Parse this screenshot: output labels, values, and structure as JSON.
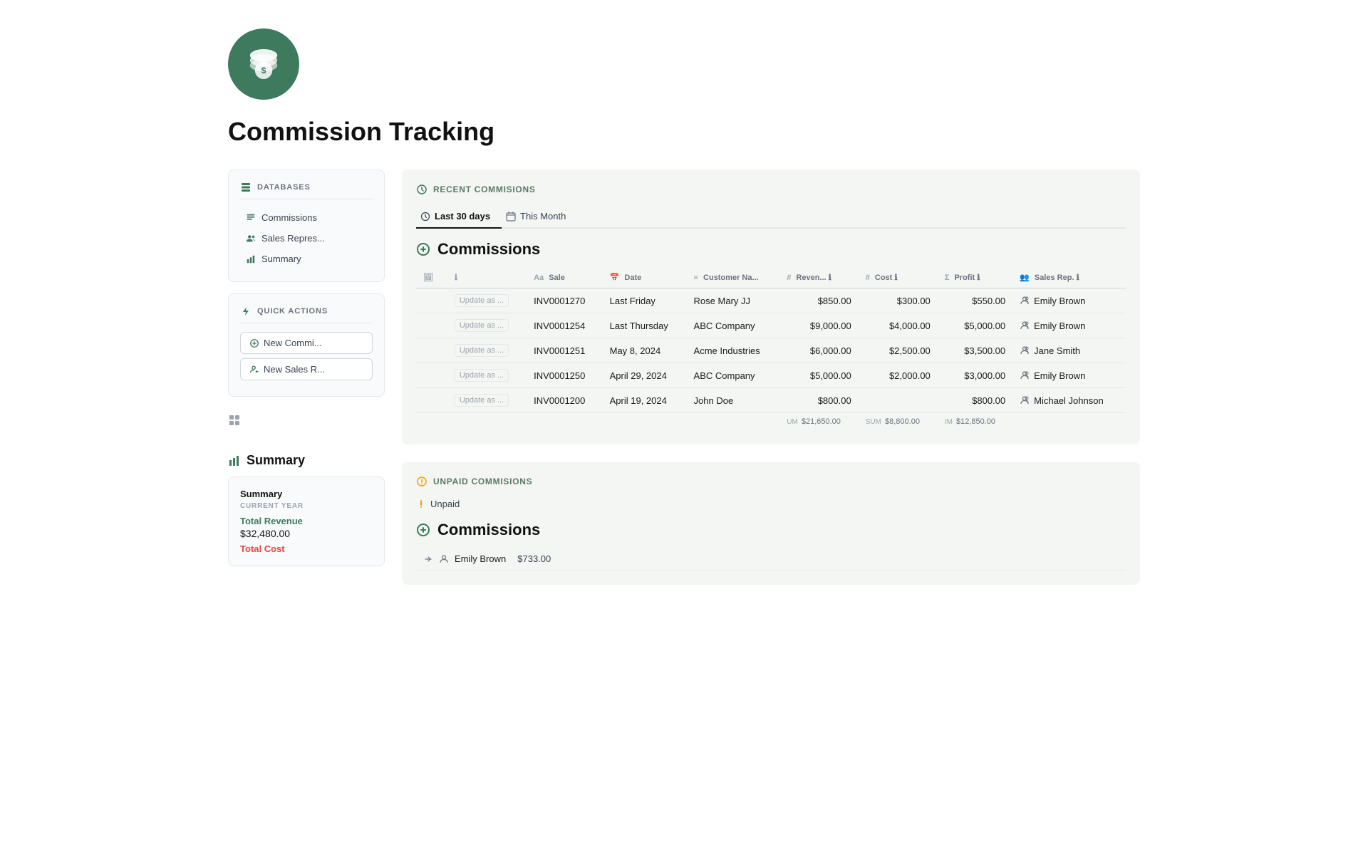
{
  "app": {
    "title": "Commission Tracking"
  },
  "sidebar": {
    "databases_label": "DATABASES",
    "items": [
      {
        "label": "Commissions",
        "icon": "commissions-icon"
      },
      {
        "label": "Sales Repres...",
        "icon": "sales-rep-icon"
      },
      {
        "label": "Summary",
        "icon": "summary-icon"
      }
    ],
    "quick_actions_label": "QUICK ACTIONS",
    "quick_actions": [
      {
        "label": "New Commi...",
        "icon": "plus-icon"
      },
      {
        "label": "New Sales R...",
        "icon": "plus-people-icon"
      }
    ]
  },
  "summary_section": {
    "title": "Summary",
    "card": {
      "heading": "Summary",
      "period_label": "CURRENT YEAR",
      "total_revenue_label": "Total Revenue",
      "total_revenue_value": "$32,480.00",
      "total_cost_label": "Total Cost"
    }
  },
  "recent_commissions": {
    "section_label": "RECENT COMMISIONS",
    "tabs": [
      {
        "label": "Last 30 days",
        "active": true
      },
      {
        "label": "This Month",
        "active": false
      }
    ],
    "table_title": "Commissions",
    "columns": [
      {
        "label": "",
        "icon": "image-icon"
      },
      {
        "label": "",
        "icon": "info-icon"
      },
      {
        "label": "Sale",
        "icon": "text-icon"
      },
      {
        "label": "Date",
        "icon": "calendar-icon"
      },
      {
        "label": "Customer Na...",
        "icon": "list-icon"
      },
      {
        "label": "Reven...",
        "icon": "hash-icon",
        "info": true
      },
      {
        "label": "Cost",
        "icon": "hash-icon",
        "info": true
      },
      {
        "label": "Profit",
        "icon": "sigma-icon",
        "info": true
      },
      {
        "label": "Sales Rep.",
        "icon": "people-icon",
        "info": true
      }
    ],
    "rows": [
      {
        "update_label": "Update as ...",
        "sale": "INV0001270",
        "date": "Last Friday",
        "customer": "Rose Mary JJ",
        "revenue": "$850.00",
        "cost": "$300.00",
        "profit": "$550.00",
        "sales_rep": "Emily Brown"
      },
      {
        "update_label": "Update as ...",
        "sale": "INV0001254",
        "date": "Last Thursday",
        "customer": "ABC Company",
        "revenue": "$9,000.00",
        "cost": "$4,000.00",
        "profit": "$5,000.00",
        "sales_rep": "Emily Brown"
      },
      {
        "update_label": "Update as ...",
        "sale": "INV0001251",
        "date": "May 8, 2024",
        "customer": "Acme Industries",
        "revenue": "$6,000.00",
        "cost": "$2,500.00",
        "profit": "$3,500.00",
        "sales_rep": "Jane Smith"
      },
      {
        "update_label": "Update as ...",
        "sale": "INV0001250",
        "date": "April 29, 2024",
        "customer": "ABC Company",
        "revenue": "$5,000.00",
        "cost": "$2,000.00",
        "profit": "$3,000.00",
        "sales_rep": "Emily Brown"
      },
      {
        "update_label": "Update as ...",
        "sale": "INV0001200",
        "date": "April 19, 2024",
        "customer": "John Doe",
        "revenue": "$800.00",
        "cost": "",
        "profit": "$800.00",
        "sales_rep": "Michael Johnson"
      }
    ],
    "sum_row": {
      "revenue_label": "UM",
      "revenue": "$21,650.00",
      "cost_label": "SUM",
      "cost": "$8,800.00",
      "profit_label": "IM",
      "profit": "$12,850.00"
    }
  },
  "unpaid_commissions": {
    "section_label": "UNPAID COMMISIONS",
    "tab_label": "Unpaid",
    "table_title": "Commissions",
    "unpaid_row": {
      "rep": "Emily Brown",
      "amount": "$733.00"
    }
  },
  "colors": {
    "brand_green": "#3d7a5e",
    "light_bg": "#f3f6f3",
    "border": "#e5e7eb"
  }
}
